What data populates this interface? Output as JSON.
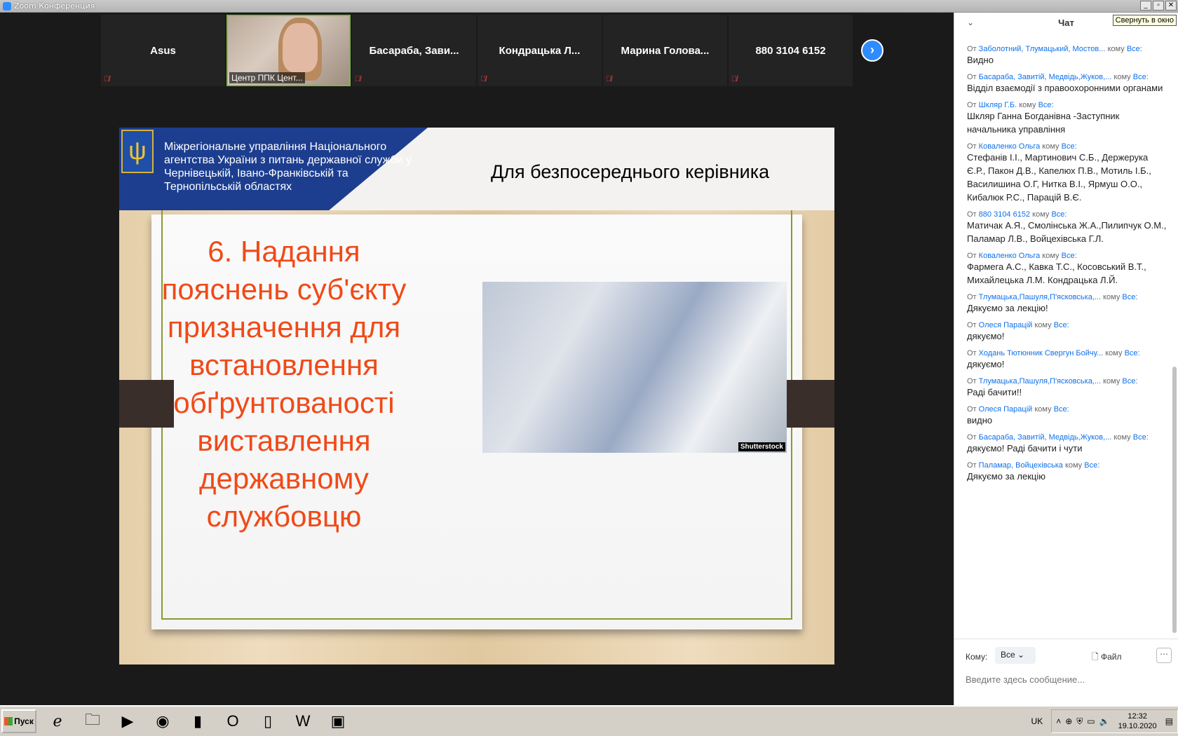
{
  "window": {
    "title": "Zoom Конференция",
    "tooltip": "Свернуть в окно"
  },
  "gallery": [
    {
      "name": "Asus",
      "muted": true
    },
    {
      "name": "Центр ППК Цент...",
      "video": true
    },
    {
      "name": "Басараба, Зави...",
      "muted": true
    },
    {
      "name": "Кондрацька Л...",
      "muted": true
    },
    {
      "name": "Марина Голова...",
      "muted": true
    },
    {
      "name": "880 3104 6152",
      "muted": true
    }
  ],
  "slide": {
    "org": "Міжрегіональне управління Національного агентства України з питань державної служби у Чернівецькій, Івано-Франківській та Тернопільській областях",
    "title": "Для безпосереднього керівника",
    "body": "6. Надання пояснень суб'єкту призначення для встановлення обґрунтованості виставлення державному службовцю",
    "photo_credit": "Shutterstock"
  },
  "chat": {
    "title": "Чат",
    "messages": [
      {
        "from": "Заболотний, Тлумацький, Мостов...",
        "to": "Все:",
        "text": "Видно"
      },
      {
        "from": "Басараба, Завитій, Медвідь,Жуков,...",
        "to": "Все:",
        "text": "Відділ взаємодії з правоохоронними органами"
      },
      {
        "from": "Шкляр Г.Б.",
        "to": "Все:",
        "text": "Шкляр Ганна Богданівна -Заступник начальника управління"
      },
      {
        "from": "Коваленко Ольга",
        "to": "Все:",
        "text": "Стефанів І.І., Мартинович С.Б., Держерука Є.Р., Пакон Д.В., Капелюх П.В., Мотиль І.Б., Василишина О.Г, Нитка В.І., Ярмуш О.О., Кибалюк Р.С., Парацій В.Є."
      },
      {
        "from": "880 3104 6152",
        "to": "Все:",
        "text": "Матичак А.Я., Смолінська Ж.А.,Пилипчук О.М., Паламар Л.В., Войцехівська Г.Л."
      },
      {
        "from": "Коваленко Ольга",
        "to": "Все:",
        "text": "Фармега А.С., Кавка Т.С., Косовський В.Т., Михайлецька Л.М. Кондрацька Л.Й."
      },
      {
        "from": "Тлумацька,Пашуля,П'ясковська,...",
        "to": "Все:",
        "text": "Дякуємо за лекцію!"
      },
      {
        "from": "Олеся Парацій",
        "to": "Все:",
        "text": "дякуємо!"
      },
      {
        "from": "Ходань Тютюнник Свергун Бойчу...",
        "to": "Все:",
        "text": "дякуємо!"
      },
      {
        "from": "Тлумацька,Пашуля,П'ясковська,...",
        "to": "Все:",
        "text": "Раді бачити!!"
      },
      {
        "from": "Олеся Парацій",
        "to": "Все:",
        "text": "видно"
      },
      {
        "from": "Басараба, Завитій, Медвідь,Жуков,...",
        "to": "Все:",
        "text": "дякуємо! Раді бачити і чути"
      },
      {
        "from": "Паламар, Войцехівська",
        "to": "Все:",
        "text": "Дякуємо за лекцію"
      }
    ],
    "from_label": "От",
    "to_label": "кому",
    "recipient_label": "Кому:",
    "recipient_value": "Все",
    "file_label": "Файл",
    "input_placeholder": "Введите здесь сообщение..."
  },
  "taskbar": {
    "start_label": "Пуск",
    "lang": "UK",
    "time": "12:32",
    "date": "19.10.2020"
  }
}
